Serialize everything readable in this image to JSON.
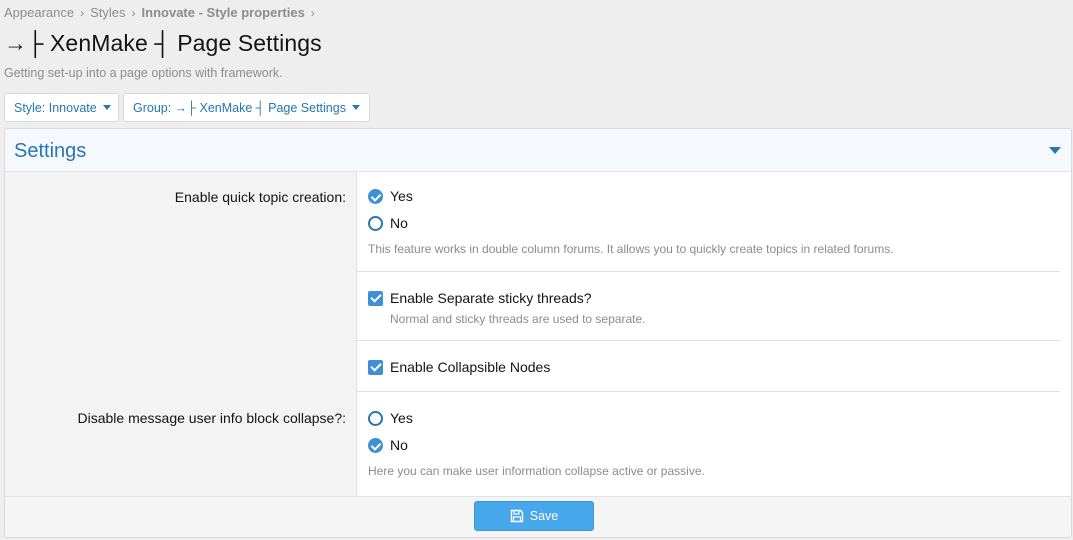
{
  "breadcrumb": {
    "items": [
      "Appearance",
      "Styles",
      "Innovate - Style properties"
    ],
    "separator": "›"
  },
  "page": {
    "title": "→├ XenMake ┤ Page Settings",
    "description": "Getting set-up into a page options with framework."
  },
  "filters": {
    "style_label": "Style: Innovate",
    "group_label": "Group: →├ XenMake ┤ Page Settings"
  },
  "settings": {
    "title": "Settings",
    "quick_topic": {
      "label": "Enable quick topic creation:",
      "options": [
        "Yes",
        "No"
      ],
      "selected": "Yes",
      "hint": "This feature works in double column forums. It allows you to quickly create topics in related forums."
    },
    "sticky_threads": {
      "label": "Enable Separate sticky threads?",
      "checked": true,
      "hint": "Normal and sticky threads are used to separate."
    },
    "collapsible_nodes": {
      "label": "Enable Collapsible Nodes",
      "checked": true
    },
    "user_info_collapse": {
      "label": "Disable message user info block collapse?:",
      "options": [
        "Yes",
        "No"
      ],
      "selected": "No",
      "hint": "Here you can make user information collapse active or passive."
    }
  },
  "footer": {
    "save_label": "Save"
  },
  "colors": {
    "accent": "#2577b1",
    "button": "#47a7eb",
    "header_bg": "#f5f9fd"
  },
  "icons": {
    "save": "save-icon",
    "collapse": "chevron-down-icon"
  }
}
